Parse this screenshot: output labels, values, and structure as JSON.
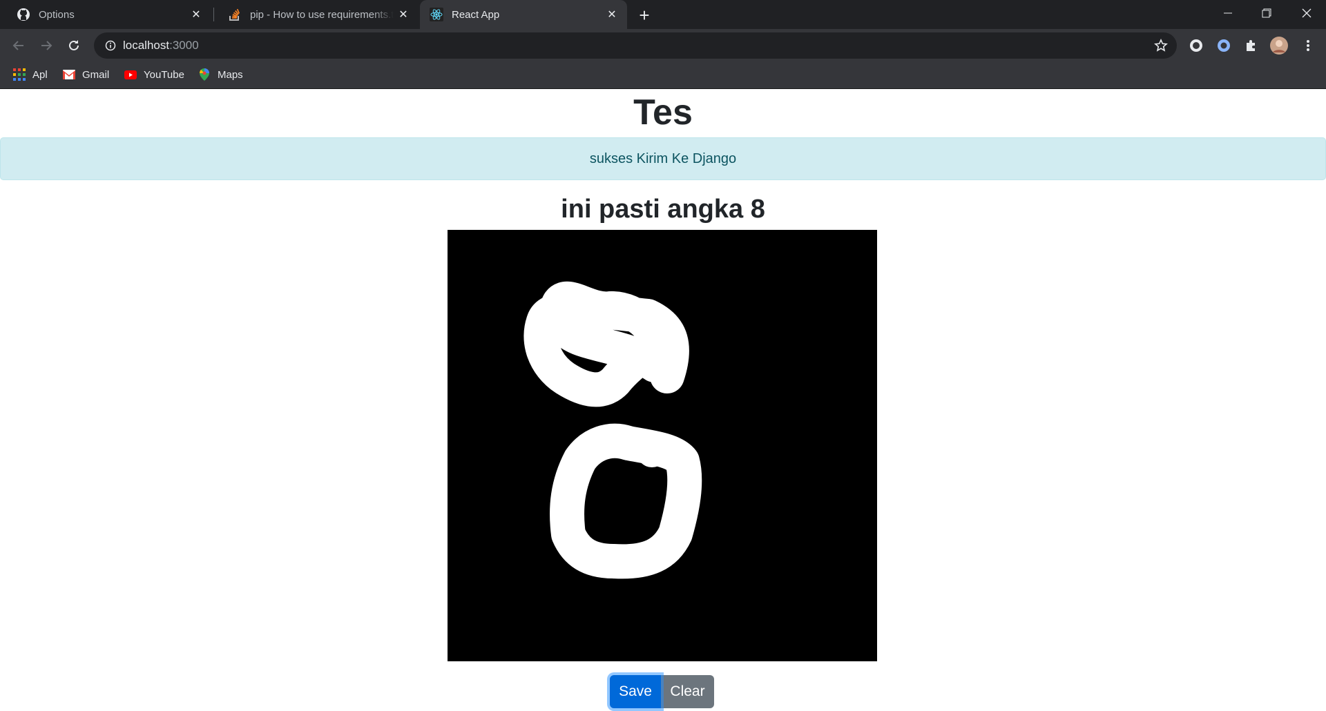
{
  "browser": {
    "tabs": [
      {
        "title": "Options",
        "icon": "github-icon",
        "active": false
      },
      {
        "title": "pip - How to use requirements.txt",
        "icon": "stackoverflow-icon",
        "active": false
      },
      {
        "title": "React App",
        "icon": "react-icon",
        "active": true
      }
    ],
    "url_host": "localhost",
    "url_port": ":3000",
    "bookmarks": [
      {
        "label": "Apl",
        "icon": "apps-grid-icon"
      },
      {
        "label": "Gmail",
        "icon": "gmail-icon"
      },
      {
        "label": "YouTube",
        "icon": "youtube-icon"
      },
      {
        "label": "Maps",
        "icon": "maps-icon"
      }
    ]
  },
  "page": {
    "title": "Tes",
    "alert": "sukses Kirim Ke Django",
    "result": "ini pasti angka 8",
    "canvas_background": "#000000",
    "stroke_color": "#ffffff",
    "buttons": {
      "save": "Save",
      "clear": "Clear"
    }
  },
  "colors": {
    "alert_bg": "#d1ecf1",
    "alert_text": "#0c5460",
    "save_button": "#0069d9",
    "clear_button": "#6c757d"
  }
}
